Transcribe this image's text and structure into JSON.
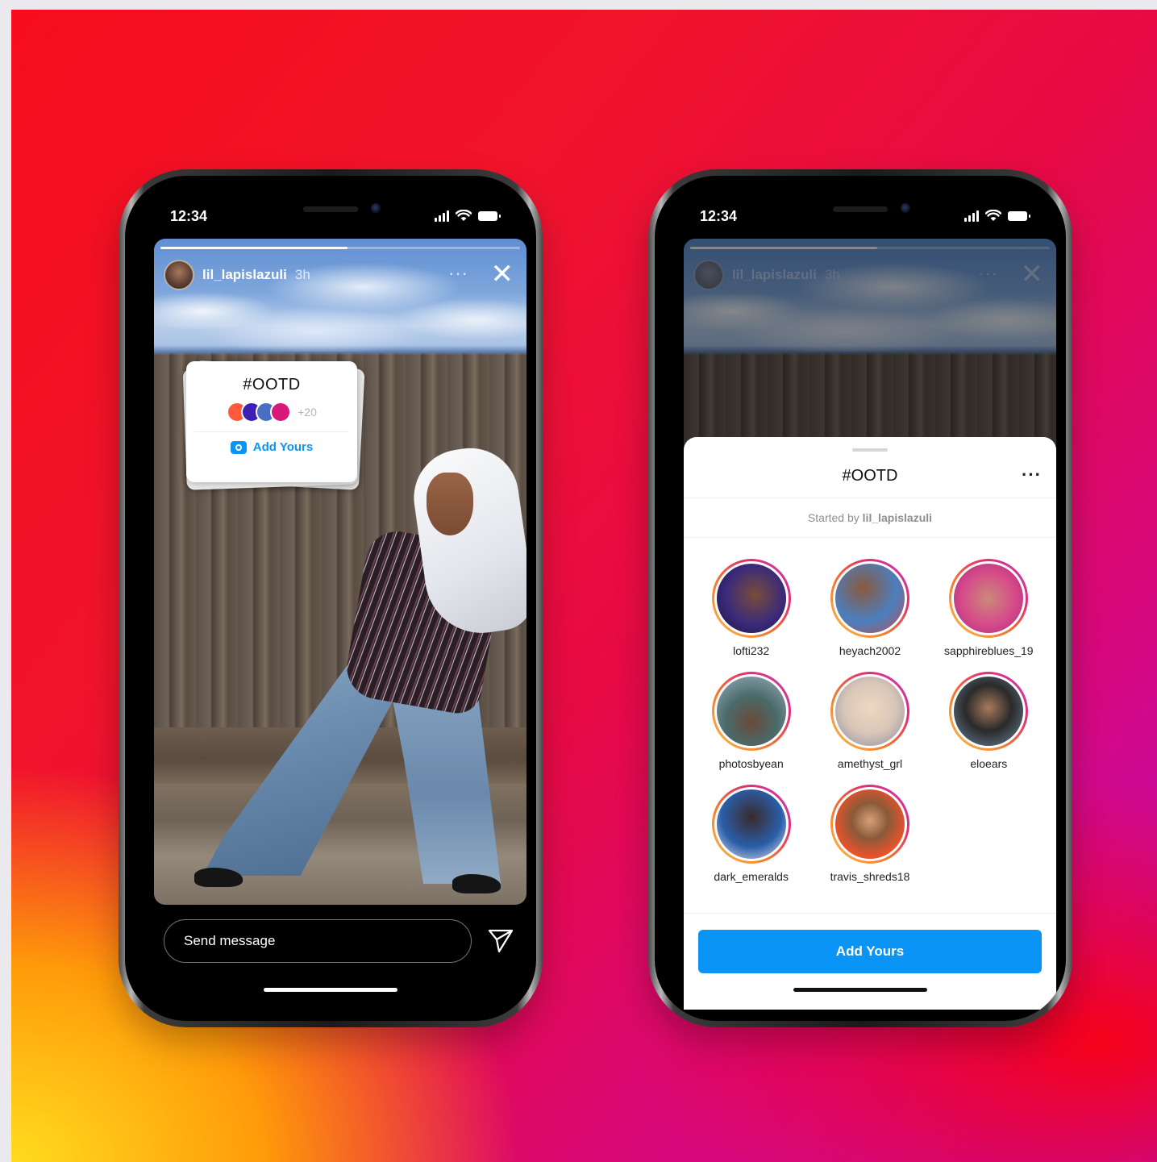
{
  "status": {
    "time": "12:34"
  },
  "story": {
    "username": "lil_lapislazuli",
    "time_ago": "3h",
    "more": "···",
    "close": "✕"
  },
  "sticker": {
    "title": "#OOTD",
    "count": "+20",
    "cta": "Add Yours",
    "avatar_colors": [
      "#ff5a3c",
      "#3d1fb5",
      "#4a6fc2",
      "#d8197a"
    ]
  },
  "message": {
    "placeholder": "Send message"
  },
  "sheet": {
    "title": "#OOTD",
    "more": "···",
    "started_prefix": "Started by",
    "started_user": "lil_lapislazuli",
    "participants": [
      {
        "name": "lofti232",
        "color": "#3a2a7a"
      },
      {
        "name": "heyach2002",
        "color": "#4b7fbf"
      },
      {
        "name": "sapphireblues_19",
        "color": "#d64a8a"
      },
      {
        "name": "photosbyean",
        "color": "#4a6a6a"
      },
      {
        "name": "amethyst_grl",
        "color": "#d8c6b8"
      },
      {
        "name": "eloears",
        "color": "#6c8aa3"
      },
      {
        "name": "dark_emeralds",
        "color": "#2a5ea8"
      },
      {
        "name": "travis_shreds18",
        "color": "#e8532a"
      }
    ],
    "button": "Add Yours"
  },
  "colors": {
    "accent": "#0a95f6",
    "ring_gradient": [
      "#fdc24d",
      "#f2762f",
      "#e22f6e",
      "#c63ac7"
    ]
  }
}
